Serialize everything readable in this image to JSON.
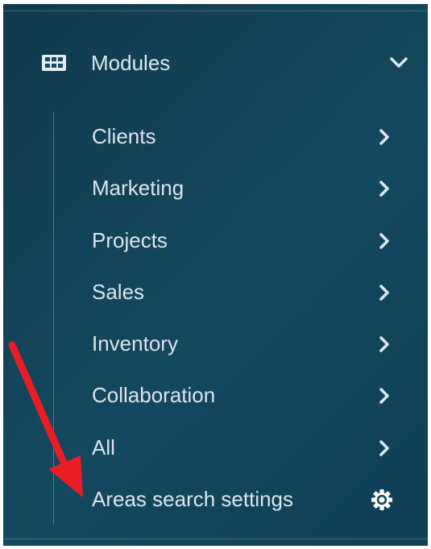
{
  "sidebar": {
    "module_header": {
      "title": "Modules",
      "icon": "grid-icon",
      "expanded_icon": "chevron-down-icon"
    },
    "items": [
      {
        "label": "Clients",
        "icon": "chevron-right-icon"
      },
      {
        "label": "Marketing",
        "icon": "chevron-right-icon"
      },
      {
        "label": "Projects",
        "icon": "chevron-right-icon"
      },
      {
        "label": "Sales",
        "icon": "chevron-right-icon"
      },
      {
        "label": "Inventory",
        "icon": "chevron-right-icon"
      },
      {
        "label": "Collaboration",
        "icon": "chevron-right-icon"
      },
      {
        "label": "All",
        "icon": "chevron-right-icon"
      },
      {
        "label": "Areas search settings",
        "icon": "gear-icon"
      }
    ]
  },
  "colors": {
    "panel_background": "#14485e",
    "text": "#dbe5eb",
    "annotation_arrow": "#ea1c24"
  }
}
